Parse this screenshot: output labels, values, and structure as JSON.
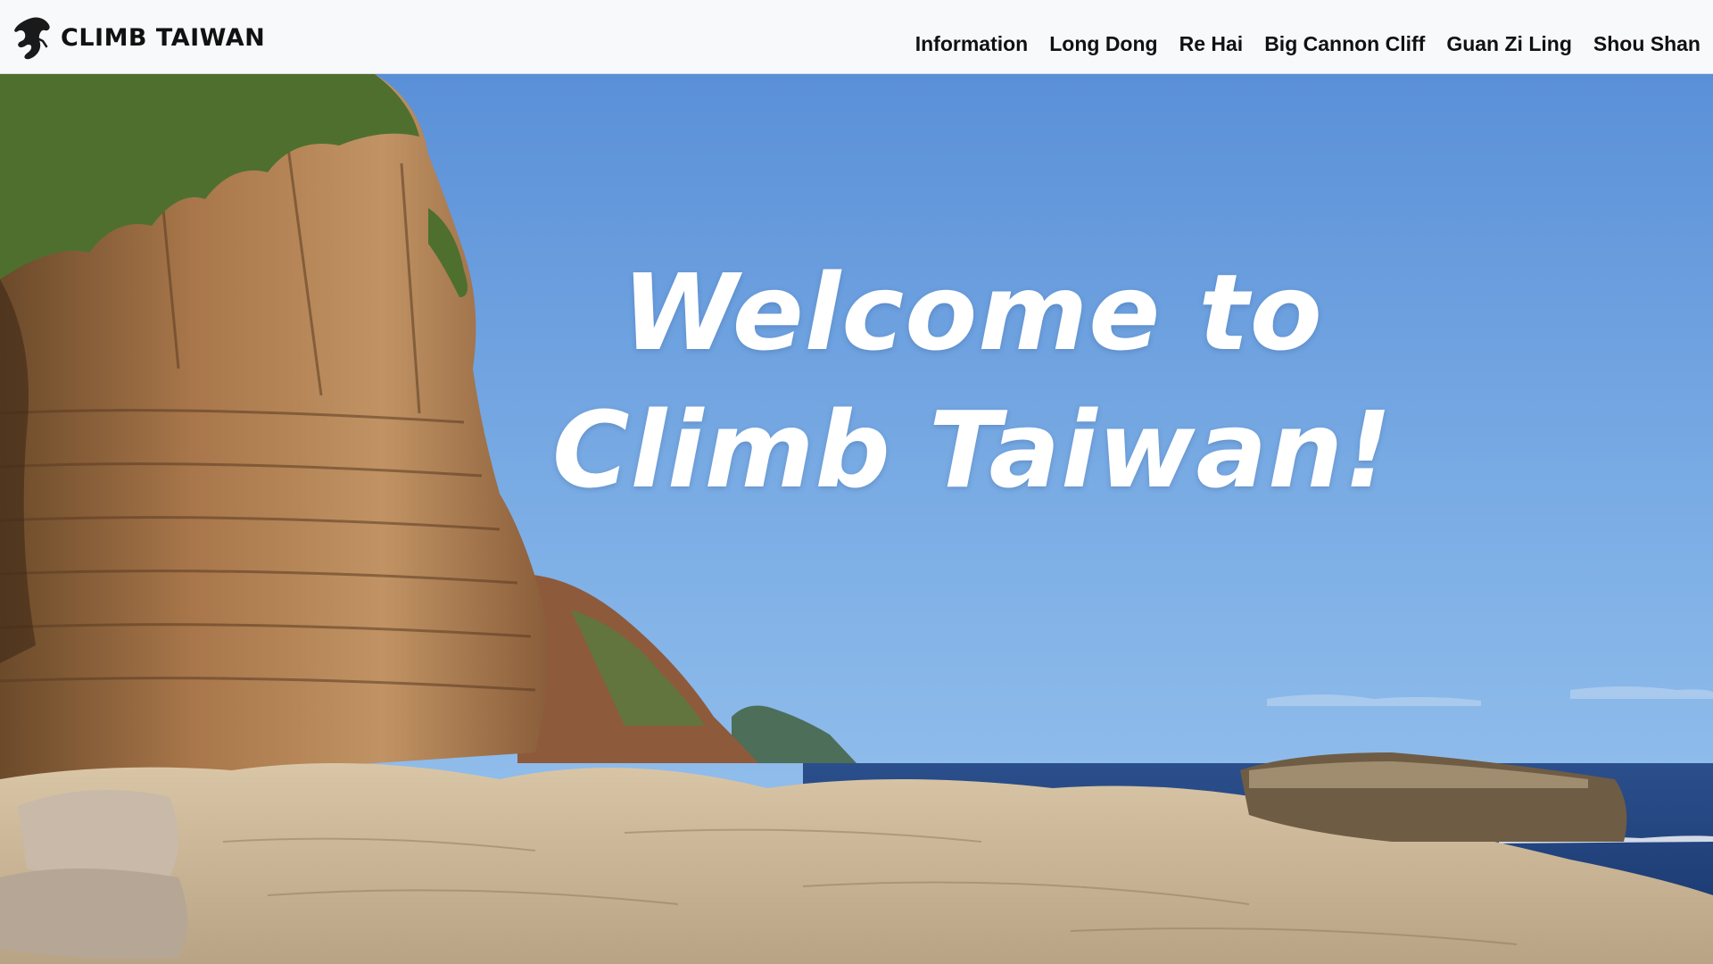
{
  "header": {
    "brand": {
      "name": "CLIMB TAIWAN",
      "logo_icon": "climber-silhouette-icon"
    },
    "nav": [
      {
        "label": "Information"
      },
      {
        "label": "Long Dong"
      },
      {
        "label": "Re Hai"
      },
      {
        "label": "Big Cannon Cliff"
      },
      {
        "label": "Guan Zi Ling"
      },
      {
        "label": "Shou Shan"
      }
    ]
  },
  "hero": {
    "title_line1": "Welcome to",
    "title_line2": "Climb Taiwan!",
    "image_subject": "coastal sandstone cliffs, rocky shore and blue sea under clear sky"
  },
  "colors": {
    "navbar_bg": "#f8f9fa",
    "nav_text": "#111111",
    "sky_top": "#5a90d8",
    "sky_bottom": "#8cbcec",
    "sea": "#1f3f78",
    "hero_text": "#ffffff"
  }
}
